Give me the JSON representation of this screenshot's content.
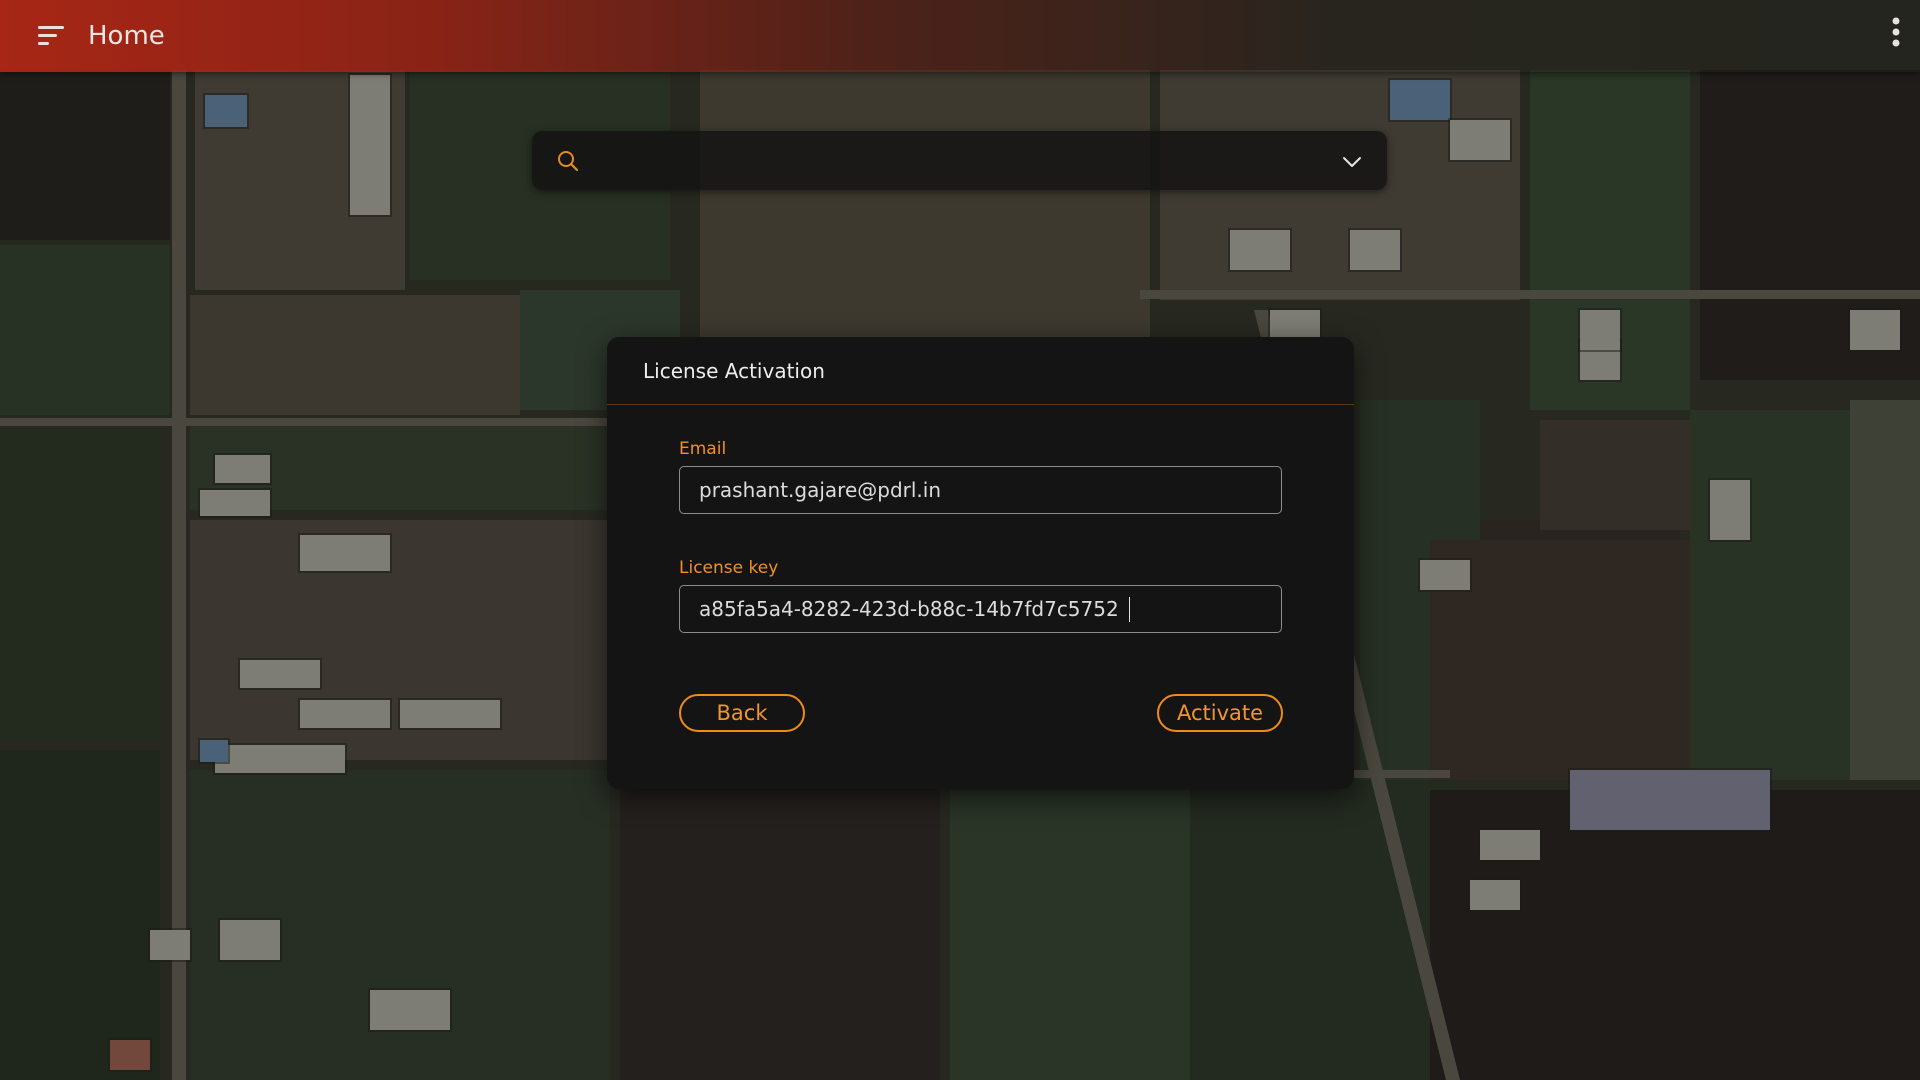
{
  "app_bar": {
    "title": "Home",
    "menu_icon": "sort-lines-icon",
    "more_icon": "more-vertical-icon"
  },
  "search": {
    "placeholder": "",
    "value": "",
    "search_icon": "search-icon",
    "dropdown_icon": "chevron-down-icon"
  },
  "dialog": {
    "title": "License Activation",
    "email_label": "Email",
    "email_value": "prashant.gajare@pdrl.in",
    "license_label": "License key",
    "license_value": "a85fa5a4-8282-423d-b88c-14b7fd7c5752",
    "back_label": "Back",
    "activate_label": "Activate"
  },
  "colors": {
    "accent": "#ef8a1c",
    "app_bar": "#b22614",
    "dialog_bg": "#151414"
  }
}
